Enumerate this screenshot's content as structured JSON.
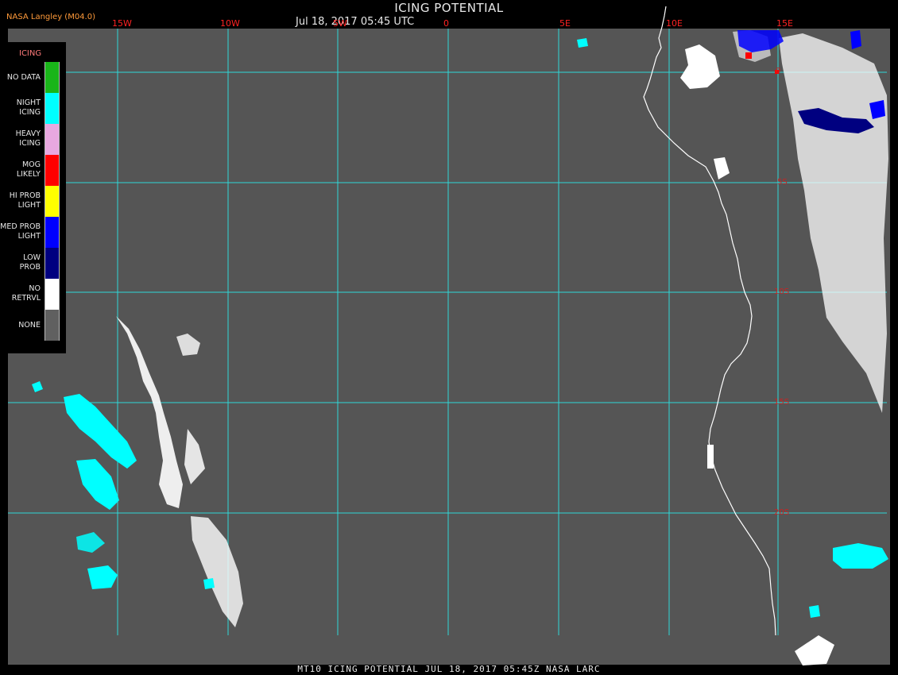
{
  "header": {
    "title": "ICING POTENTIAL",
    "subtitle": "Jul 18, 2017 05:45 UTC",
    "credit": "NASA Langley (M04.0)"
  },
  "footer": {
    "text": "MT10  ICING POTENTIAL   JUL 18, 2017 05:45Z  NASA LARC"
  },
  "legend": {
    "title": "ICING",
    "items": [
      {
        "label": "NO DATA",
        "color": "#19b519"
      },
      {
        "label": "NIGHT\nICING",
        "color": "#00ffff"
      },
      {
        "label": "HEAVY\nICING",
        "color": "#e8a8e0"
      },
      {
        "label": "MOG\nLIKELY",
        "color": "#ff0000"
      },
      {
        "label": "HI PROB\nLIGHT",
        "color": "#ffff00"
      },
      {
        "label": "MED PROB\nLIGHT",
        "color": "#0000ff"
      },
      {
        "label": "LOW\nPROB",
        "color": "#000080"
      },
      {
        "label": "NO\nRETRVL",
        "color": "#ffffff"
      },
      {
        "label": "NONE",
        "color": "#606060"
      }
    ]
  },
  "grid": {
    "longitude_labels": [
      "15W",
      "10W",
      "5W",
      "0",
      "5E",
      "10E",
      "15E"
    ],
    "latitude_labels": [
      "0",
      "5S",
      "10S",
      "15S",
      "20S"
    ]
  },
  "colors": {
    "background": "#555555",
    "grid": "#2ed8d8",
    "coastline": "#ffffff",
    "label": "#ff2222"
  }
}
